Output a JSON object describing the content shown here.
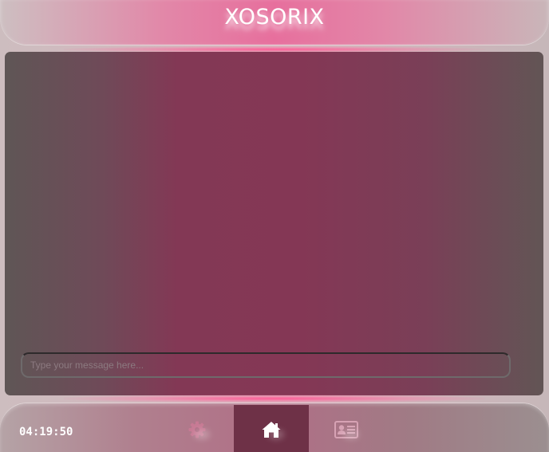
{
  "app": {
    "title": "XOSORIX"
  },
  "chat": {
    "input_placeholder": "Type your message here...",
    "input_value": ""
  },
  "footer": {
    "clock": "04:19:50",
    "nav": [
      {
        "id": "settings",
        "icon": "gear-icon",
        "active": false
      },
      {
        "id": "home",
        "icon": "home-icon",
        "active": true
      },
      {
        "id": "profile",
        "icon": "id-card-icon",
        "active": false
      }
    ]
  },
  "colors": {
    "header_accent": "#e76f9d",
    "panel": "#843755",
    "active_nav": "#6e3147"
  }
}
